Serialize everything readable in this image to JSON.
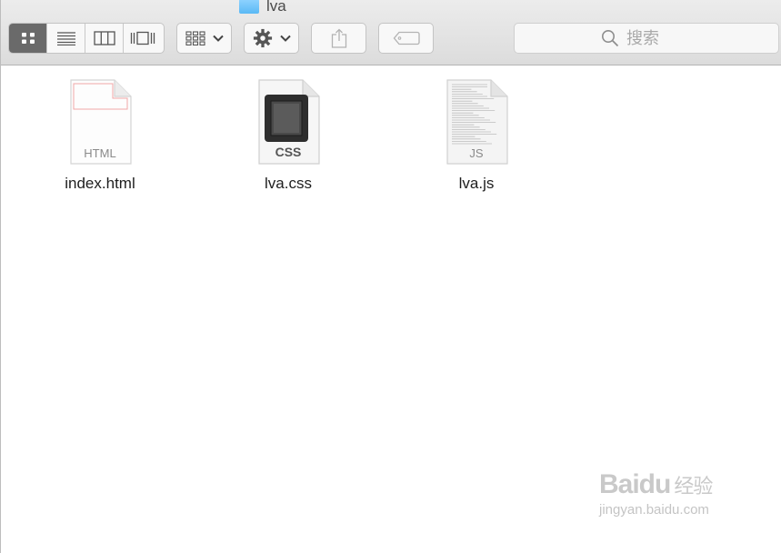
{
  "window": {
    "title": "lva"
  },
  "toolbar": {
    "view_modes": [
      "icon-view",
      "list-view",
      "column-view",
      "cover-flow-view"
    ],
    "active_view": "icon-view",
    "arrange_icon": "grid-arrange-icon",
    "action_icon": "gear-icon",
    "share_icon": "share-icon",
    "tag_icon": "tag-icon"
  },
  "search": {
    "placeholder": "搜索"
  },
  "files": [
    {
      "name": "index.html",
      "kind": "HTML"
    },
    {
      "name": "lva.css",
      "kind": "CSS"
    },
    {
      "name": "lva.js",
      "kind": "JS"
    }
  ],
  "watermark": {
    "brand_main": "Baidu",
    "brand_suffix": "经验",
    "url": "jingyan.baidu.com"
  },
  "colors": {
    "active_segment": "#6a6a6a",
    "folder": "#5ab9f5"
  }
}
